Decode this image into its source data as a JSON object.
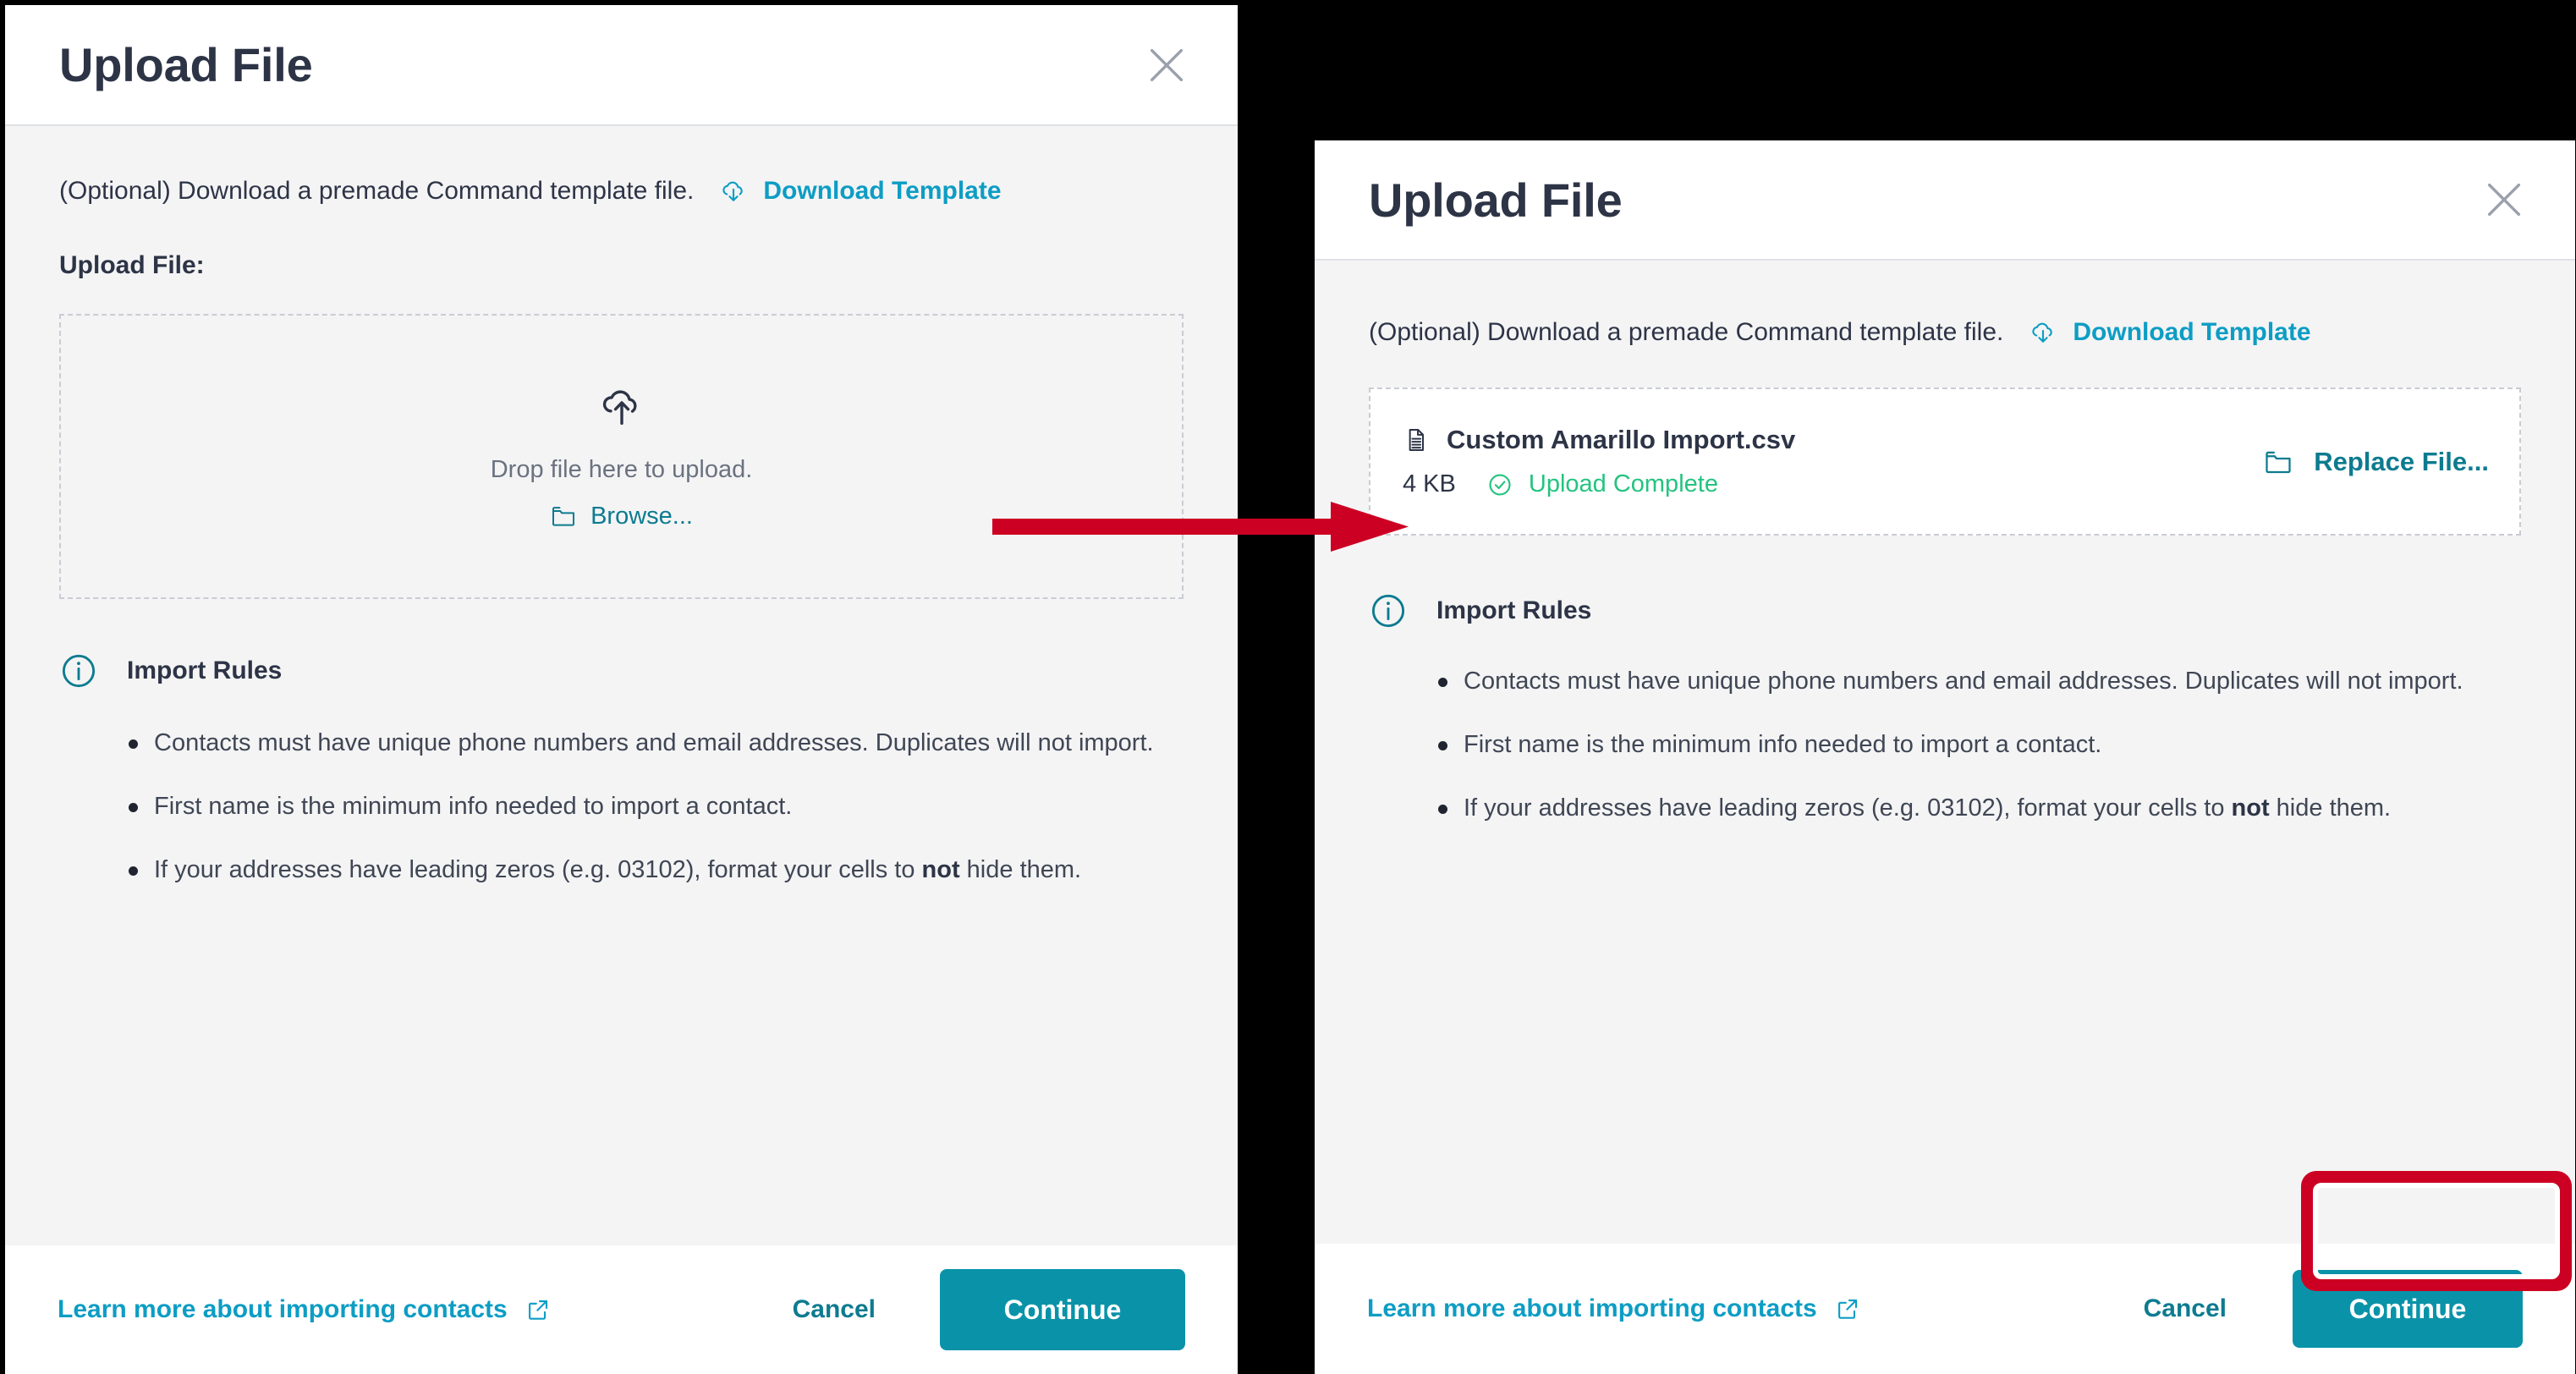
{
  "colors": {
    "accent_teal": "#0a93a8",
    "link_cyan": "#0d9dc4",
    "link_teal_dark": "#0d7b8f",
    "title_dark": "#2d3446",
    "success_green": "#24c37f",
    "annotation_red": "#CC0022",
    "body_bg": "#f4f4f5",
    "panel_white": "#ffffff",
    "dashed_border": "#c9ccd2"
  },
  "left_dialog": {
    "title": "Upload File",
    "close_icon": "close-icon",
    "template": {
      "note": "(Optional) Download a premade Command template file.",
      "download_label": "Download Template",
      "download_icon": "cloud-download-icon"
    },
    "upload_label": "Upload File:",
    "dropzone": {
      "icon": "cloud-upload-icon",
      "drop_text": "Drop file here to upload.",
      "browse_label": "Browse...",
      "browse_icon": "folder-icon"
    },
    "rules": {
      "icon": "info-circle-icon",
      "title": "Import Rules",
      "items": [
        "Contacts must have unique phone numbers and email addresses. Duplicates will not import.",
        "First name is the minimum info needed to import a contact.",
        "If your addresses have leading zeros (e.g. 03102), format your cells to "
      ],
      "item3_bold": "not",
      "item3_tail": " hide them."
    },
    "footer": {
      "learn_label": "Learn more about importing contacts",
      "learn_icon": "external-link-icon",
      "cancel_label": "Cancel",
      "continue_label": "Continue"
    }
  },
  "right_dialog": {
    "title": "Upload File",
    "close_icon": "close-icon",
    "template": {
      "note": "(Optional) Download a premade Command template file.",
      "download_label": "Download Template",
      "download_icon": "cloud-download-icon"
    },
    "file": {
      "icon": "file-csv-icon",
      "name": "Custom Amarillo Import.csv",
      "size": "4 KB",
      "status": "Upload Complete",
      "status_icon": "check-circle-icon",
      "replace_label": "Replace File...",
      "replace_icon": "folder-icon"
    },
    "rules": {
      "icon": "info-circle-icon",
      "title": "Import Rules",
      "items": [
        "Contacts must have unique phone numbers and email addresses. Duplicates will not import.",
        "First name is the minimum info needed to import a contact.",
        "If your addresses have leading zeros (e.g. 03102), format your cells to "
      ],
      "item3_bold": "not",
      "item3_tail": " hide them."
    },
    "footer": {
      "learn_label": "Learn more about importing contacts",
      "learn_icon": "external-link-icon",
      "cancel_label": "Cancel",
      "continue_label": "Continue"
    }
  },
  "annotations": {
    "arrow_name": "red-pointer-arrow",
    "highlight_name": "red-highlight-box"
  }
}
